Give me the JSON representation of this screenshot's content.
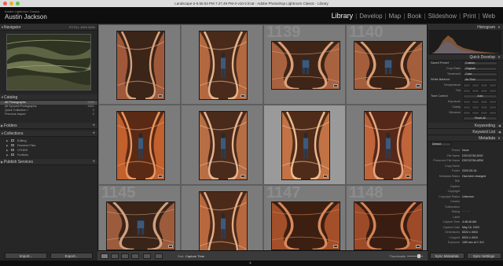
{
  "window": {
    "title": "Landscape-2-6.56.53 PM 7.27.49 PM-2-v10-2.lrcat - Adobe Photoshop Lightroom Classic - Library",
    "traffic_colors": [
      "#ec5f57",
      "#e0b42f",
      "#5fc24b"
    ]
  },
  "identity": {
    "line1": "Adobe Lightroom Classic",
    "name": "Austin Jackson"
  },
  "modules": [
    "Library",
    "Develop",
    "Map",
    "Book",
    "Slideshow",
    "Print",
    "Web"
  ],
  "active_module": "Library",
  "left": {
    "navigator": {
      "title": "Navigator",
      "opts": [
        "FIT",
        "FILL",
        "100%",
        "300%"
      ]
    },
    "catalog": {
      "title": "Catalog",
      "items": [
        {
          "label": "All Photographs",
          "count": "3209",
          "selected": true
        },
        {
          "label": "All Synced Photographs",
          "count": "4801"
        },
        {
          "label": "Quick Collection +",
          "count": "0"
        },
        {
          "label": "Previous Import",
          "count": "0"
        }
      ]
    },
    "folders": {
      "title": "Folders"
    },
    "collections": {
      "title": "Collections",
      "items": [
        "Editing",
        "Finished Files",
        "OTHER",
        "Portfolio"
      ]
    },
    "publish": {
      "title": "Publish Services"
    },
    "buttons": {
      "import": "Import...",
      "export": "Export..."
    }
  },
  "right": {
    "histogram": {
      "title": "Histogram"
    },
    "quick_develop": {
      "title": "Quick Develop",
      "saved_preset_label": "Saved Preset",
      "saved_preset_value": "Custom",
      "crop_ratio_label": "Crop Ratio",
      "crop_ratio_value": "Original",
      "treatment_label": "Treatment",
      "treatment_value": "Color",
      "white_balance_label": "White Balance",
      "white_balance_value": "As Shot",
      "temperature_label": "Temperature",
      "tint_label": "Tint",
      "tone_control_label": "Tone Control",
      "auto_label": "Auto",
      "exposure_label": "Exposure",
      "clarity_label": "Clarity",
      "vibrance_label": "Vibrance",
      "reset_label": "Reset All"
    },
    "keywording": {
      "title": "Keywording"
    },
    "keyword_list": {
      "title": "Keyword List"
    },
    "metadata": {
      "title": "Metadata",
      "left_dropdown": "Default",
      "right_dropdown": "",
      "preset_label": "Preset",
      "preset_value": "None",
      "rows": [
        {
          "label": "File Name",
          "value": "DSC02784.DNG"
        },
        {
          "label": "Preserved File Name",
          "value": "DSC02784.ARW"
        },
        {
          "label": "Copy Name",
          "value": ""
        },
        {
          "label": "Folder",
          "value": "2020-05-16"
        },
        {
          "label": "Metadata Status",
          "value": "Has been changed"
        },
        {
          "label": "Title",
          "value": ""
        },
        {
          "label": "Caption",
          "value": ""
        },
        {
          "label": "Copyright",
          "value": ""
        },
        {
          "label": "Copyright Status",
          "value": "Unknown"
        },
        {
          "label": "Creator",
          "value": ""
        },
        {
          "label": "Sublocation",
          "value": ""
        },
        {
          "label": "Rating",
          "value": "· · · · ·"
        },
        {
          "label": "Label",
          "value": ""
        },
        {
          "label": "Capture Time",
          "value": "4:48:46 AM"
        },
        {
          "label": "Capture Date",
          "value": "May 16, 2020"
        },
        {
          "label": "Dimensions",
          "value": "6024 x 4016"
        },
        {
          "label": "Cropped",
          "value": "6024 x 4016"
        },
        {
          "label": "Exposure",
          "value": "1/60 sec at f / 8.0"
        }
      ]
    },
    "buttons": {
      "sync_metadata": "Sync Metadata",
      "sync_settings": "Sync Settings"
    }
  },
  "grid": {
    "cells": [
      {
        "num": "",
        "scene": "slot-dark",
        "selected": false
      },
      {
        "num": "",
        "scene": "slot-hiker",
        "selected": false
      },
      {
        "num": "1139",
        "scene": "slot-wide",
        "selected": false
      },
      {
        "num": "1140",
        "scene": "slot-wide-hiker",
        "selected": false
      },
      {
        "num": "",
        "scene": "slot-climb",
        "selected": false
      },
      {
        "num": "",
        "scene": "slot-stand",
        "selected": false
      },
      {
        "num": "",
        "scene": "slot-jump",
        "selected": true
      },
      {
        "num": "",
        "scene": "slot-narrow",
        "selected": false
      },
      {
        "num": "1145",
        "scene": "slot-photographer",
        "selected": false
      },
      {
        "num": "",
        "scene": "slot-narrow2",
        "selected": false
      },
      {
        "num": "1147",
        "scene": "slot-waves",
        "selected": false
      },
      {
        "num": "1148",
        "scene": "slot-waves2",
        "selected": false
      }
    ]
  },
  "toolbar": {
    "sort_label": "Sort:",
    "sort_value": "Capture Time",
    "thumbnails_label": "Thumbnails",
    "thumbnail_size": 0.8
  }
}
